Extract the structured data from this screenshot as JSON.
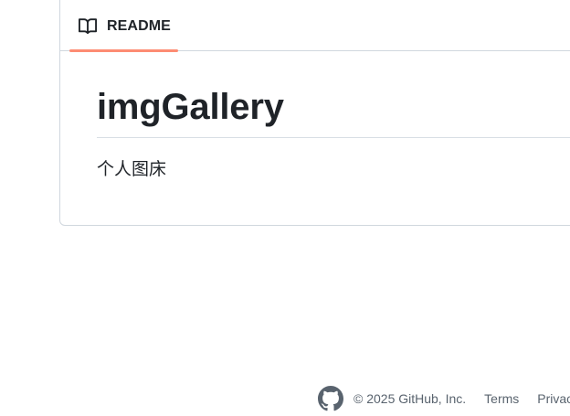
{
  "readme": {
    "tab_label": "README",
    "title": "imgGallery",
    "description": "个人图床",
    "tab_accent_color": "#fd8c73"
  },
  "footer": {
    "copyright": "© 2025 GitHub, Inc.",
    "links": [
      "Terms",
      "Privacy"
    ],
    "logo_icon": "github-logo-icon"
  }
}
